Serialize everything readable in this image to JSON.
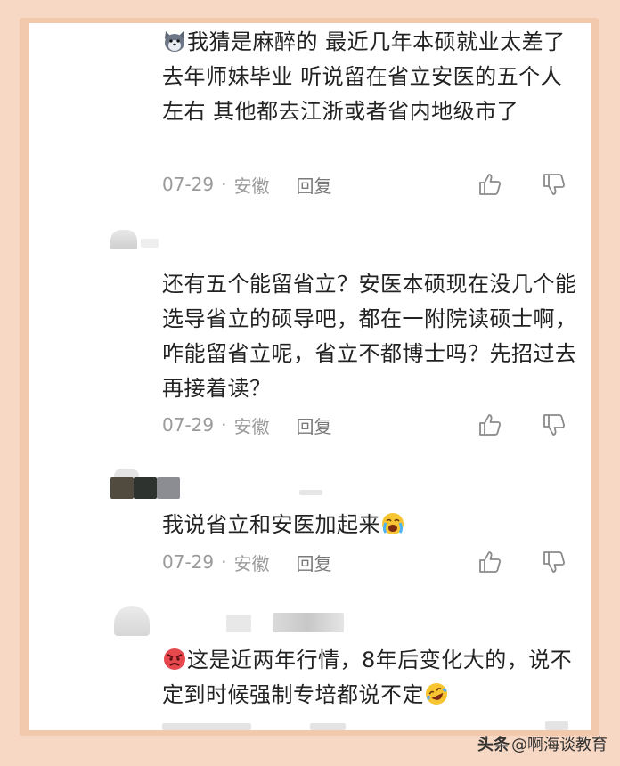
{
  "comments": [
    {
      "text": "我猜是麻醉的 最近几年本硕就业太差了 去年师妹毕业 听说留在省立安医的五个人左右 其他都去江浙或者省内地级市了",
      "date": "07-29",
      "location": "安徽",
      "reply": "回复",
      "leading_emoji": "wolf-face-emoji"
    },
    {
      "text": "还有五个能留省立？安医本硕现在没几个能选导省立的硕导吧，都在一附院读硕士啊，咋能留省立呢，省立不都博士吗？先招过去再接着读？",
      "date": "07-29",
      "location": "安徽",
      "reply": "回复"
    },
    {
      "text": "我说省立和安医加起来",
      "date": "07-29",
      "location": "安徽",
      "reply": "回复",
      "trailing_emoji": "crying-face-emoji"
    },
    {
      "text": "这是近两年行情，8年后变化大的，说不定到时候强制专培都说不定",
      "leading_emoji": "angry-face-emoji",
      "trailing_emoji": "rofl-face-emoji"
    }
  ],
  "watermark": {
    "brand": "头条",
    "account": "@啊海谈教育"
  },
  "colors": {
    "background": "#f6d8c4",
    "frame": "#f3c9ae",
    "text": "#222222",
    "meta": "#9a9a9a"
  }
}
